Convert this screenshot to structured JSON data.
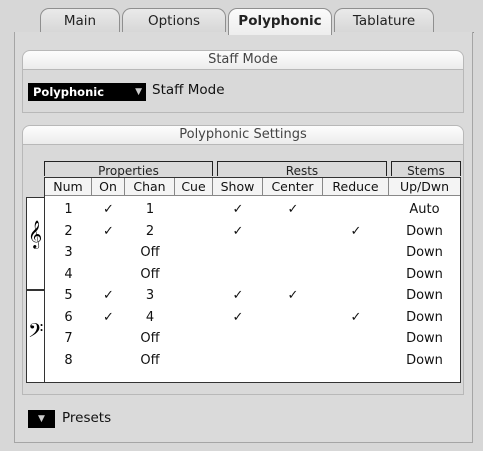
{
  "tabs": [
    {
      "label": "Main"
    },
    {
      "label": "Options"
    },
    {
      "label": "Polyphonic"
    },
    {
      "label": "Tablature"
    }
  ],
  "staff_mode": {
    "title": "Staff Mode",
    "dropdown_value": "Polyphonic",
    "label": "Staff Mode"
  },
  "poly_settings": {
    "title": "Polyphonic Settings",
    "groups": {
      "properties": "Properties",
      "rests": "Rests",
      "stems": "Stems"
    },
    "headers": {
      "num": "Num",
      "on": "On",
      "chan": "Chan",
      "cue": "Cue",
      "show": "Show",
      "center": "Center",
      "reduce": "Reduce",
      "updwn": "Up/Dwn"
    },
    "rows": [
      {
        "num": "1",
        "on": "✓",
        "chan": "1",
        "cue": "",
        "show": "✓",
        "center": "✓",
        "reduce": "",
        "updwn": "Auto"
      },
      {
        "num": "2",
        "on": "✓",
        "chan": "2",
        "cue": "",
        "show": "✓",
        "center": "",
        "reduce": "✓",
        "updwn": "Down"
      },
      {
        "num": "3",
        "on": "",
        "chan": "Off",
        "cue": "",
        "show": "",
        "center": "",
        "reduce": "",
        "updwn": "Down"
      },
      {
        "num": "4",
        "on": "",
        "chan": "Off",
        "cue": "",
        "show": "",
        "center": "",
        "reduce": "",
        "updwn": "Down"
      },
      {
        "num": "5",
        "on": "✓",
        "chan": "3",
        "cue": "",
        "show": "✓",
        "center": "✓",
        "reduce": "",
        "updwn": "Down"
      },
      {
        "num": "6",
        "on": "✓",
        "chan": "4",
        "cue": "",
        "show": "✓",
        "center": "",
        "reduce": "✓",
        "updwn": "Down"
      },
      {
        "num": "7",
        "on": "",
        "chan": "Off",
        "cue": "",
        "show": "",
        "center": "",
        "reduce": "",
        "updwn": "Down"
      },
      {
        "num": "8",
        "on": "",
        "chan": "Off",
        "cue": "",
        "show": "",
        "center": "",
        "reduce": "",
        "updwn": "Down"
      }
    ],
    "treble_clef": "𝄞",
    "bass_clef": "𝄢"
  },
  "presets": {
    "label": "Presets"
  }
}
